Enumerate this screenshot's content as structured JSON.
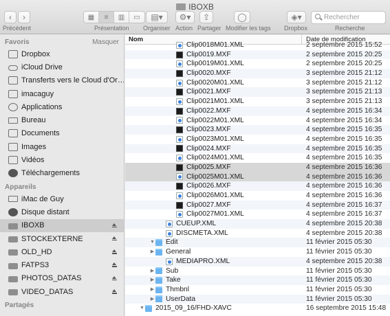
{
  "window": {
    "title": "IBOXB"
  },
  "toolbar": {
    "back_label": "Précédent",
    "view_label": "Présentation",
    "arrange_label": "Organiser",
    "action_label": "Action",
    "share_label": "Partager",
    "tags_label": "Modifier les tags",
    "dropbox_label": "Dropbox",
    "search_label": "Recherche",
    "search_placeholder": "Rechercher"
  },
  "sidebar": {
    "favorites_heading": "Favoris",
    "hide_label": "Masquer",
    "favorites": [
      {
        "label": "Dropbox",
        "icon": "dropbox-icon"
      },
      {
        "label": "iCloud Drive",
        "icon": "cloud-icon"
      },
      {
        "label": "Transferts vers le Cloud d'Or…",
        "icon": "folder-icon"
      },
      {
        "label": "imacaguy",
        "icon": "home-icon"
      },
      {
        "label": "Applications",
        "icon": "applications-icon"
      },
      {
        "label": "Bureau",
        "icon": "desktop-icon"
      },
      {
        "label": "Documents",
        "icon": "documents-icon"
      },
      {
        "label": "Images",
        "icon": "camera-icon"
      },
      {
        "label": "Vidéos",
        "icon": "film-icon"
      },
      {
        "label": "Téléchargements",
        "icon": "download-icon"
      }
    ],
    "devices_heading": "Appareils",
    "devices": [
      {
        "label": "iMac de Guy",
        "icon": "imac-icon"
      },
      {
        "label": "Disque distant",
        "icon": "disc-icon"
      },
      {
        "label": "IBOXB",
        "icon": "drive-icon"
      },
      {
        "label": "STOCKEXTERNE",
        "icon": "drive-icon"
      },
      {
        "label": "OLD_HD",
        "icon": "drive-icon"
      },
      {
        "label": "FATPS3",
        "icon": "drive-icon"
      },
      {
        "label": "PHOTOS_DATAS",
        "icon": "drive-icon"
      },
      {
        "label": "VIDEO_DATAS",
        "icon": "drive-icon"
      }
    ],
    "shared_heading": "Partagés"
  },
  "list": {
    "col_name": "Nom",
    "col_date": "Date de modification",
    "rows": [
      {
        "name": "Clip0018M01.XML",
        "date": "2 septembre 2015 15:52",
        "type": "xml",
        "indent": 3
      },
      {
        "name": "Clip0019.MXF",
        "date": "2 septembre 2015 20:25",
        "type": "mxf",
        "indent": 3
      },
      {
        "name": "Clip0019M01.XML",
        "date": "2 septembre 2015 20:25",
        "type": "xml",
        "indent": 3
      },
      {
        "name": "Clip0020.MXF",
        "date": "3 septembre 2015 21:12",
        "type": "mxf",
        "indent": 3
      },
      {
        "name": "Clip0020M01.XML",
        "date": "3 septembre 2015 21:12",
        "type": "xml",
        "indent": 3
      },
      {
        "name": "Clip0021.MXF",
        "date": "3 septembre 2015 21:13",
        "type": "mxf",
        "indent": 3
      },
      {
        "name": "Clip0021M01.XML",
        "date": "3 septembre 2015 21:13",
        "type": "xml",
        "indent": 3
      },
      {
        "name": "Clip0022.MXF",
        "date": "4 septembre 2015 16:34",
        "type": "mxf",
        "indent": 3
      },
      {
        "name": "Clip0022M01.XML",
        "date": "4 septembre 2015 16:34",
        "type": "xml",
        "indent": 3
      },
      {
        "name": "Clip0023.MXF",
        "date": "4 septembre 2015 16:35",
        "type": "mxf",
        "indent": 3
      },
      {
        "name": "Clip0023M01.XML",
        "date": "4 septembre 2015 16:35",
        "type": "xml",
        "indent": 3
      },
      {
        "name": "Clip0024.MXF",
        "date": "4 septembre 2015 16:35",
        "type": "mxf",
        "indent": 3
      },
      {
        "name": "Clip0024M01.XML",
        "date": "4 septembre 2015 16:35",
        "type": "xml",
        "indent": 3
      },
      {
        "name": "Clip0025.MXF",
        "date": "4 septembre 2015 16:36",
        "type": "mxf",
        "indent": 3,
        "selected": true
      },
      {
        "name": "Clip0025M01.XML",
        "date": "4 septembre 2015 16:36",
        "type": "xml",
        "indent": 3,
        "selected": true
      },
      {
        "name": "Clip0026.MXF",
        "date": "4 septembre 2015 16:36",
        "type": "mxf",
        "indent": 3
      },
      {
        "name": "Clip0026M01.XML",
        "date": "4 septembre 2015 16:36",
        "type": "xml",
        "indent": 3
      },
      {
        "name": "Clip0027.MXF",
        "date": "4 septembre 2015 16:37",
        "type": "mxf",
        "indent": 3
      },
      {
        "name": "Clip0027M01.XML",
        "date": "4 septembre 2015 16:37",
        "type": "xml",
        "indent": 3
      },
      {
        "name": "CUEUP.XML",
        "date": "4 septembre 2015 20:38",
        "type": "xml",
        "indent": 2
      },
      {
        "name": "DISCMETA.XML",
        "date": "4 septembre 2015 20:38",
        "type": "xml",
        "indent": 2
      },
      {
        "name": "Edit",
        "date": "11 février 2015 05:30",
        "type": "folder",
        "indent": 1,
        "disclosure": "open"
      },
      {
        "name": "General",
        "date": "11 février 2015 05:30",
        "type": "folder",
        "indent": 1,
        "disclosure": "closed"
      },
      {
        "name": "MEDIAPRO.XML",
        "date": "4 septembre 2015 20:38",
        "type": "xml",
        "indent": 2
      },
      {
        "name": "Sub",
        "date": "11 février 2015 05:30",
        "type": "folder",
        "indent": 1,
        "disclosure": "closed"
      },
      {
        "name": "Take",
        "date": "11 février 2015 05:30",
        "type": "folder",
        "indent": 1,
        "disclosure": "closed"
      },
      {
        "name": "Thmbnl",
        "date": "11 février 2015 05:30",
        "type": "folder",
        "indent": 1,
        "disclosure": "closed"
      },
      {
        "name": "UserData",
        "date": "11 février 2015 05:30",
        "type": "folder",
        "indent": 1,
        "disclosure": "closed"
      },
      {
        "name": "2015_09_16/FHD-XAVC",
        "date": "16 septembre 2015 15:48",
        "type": "folder",
        "indent": 0,
        "disclosure": "open"
      }
    ]
  }
}
